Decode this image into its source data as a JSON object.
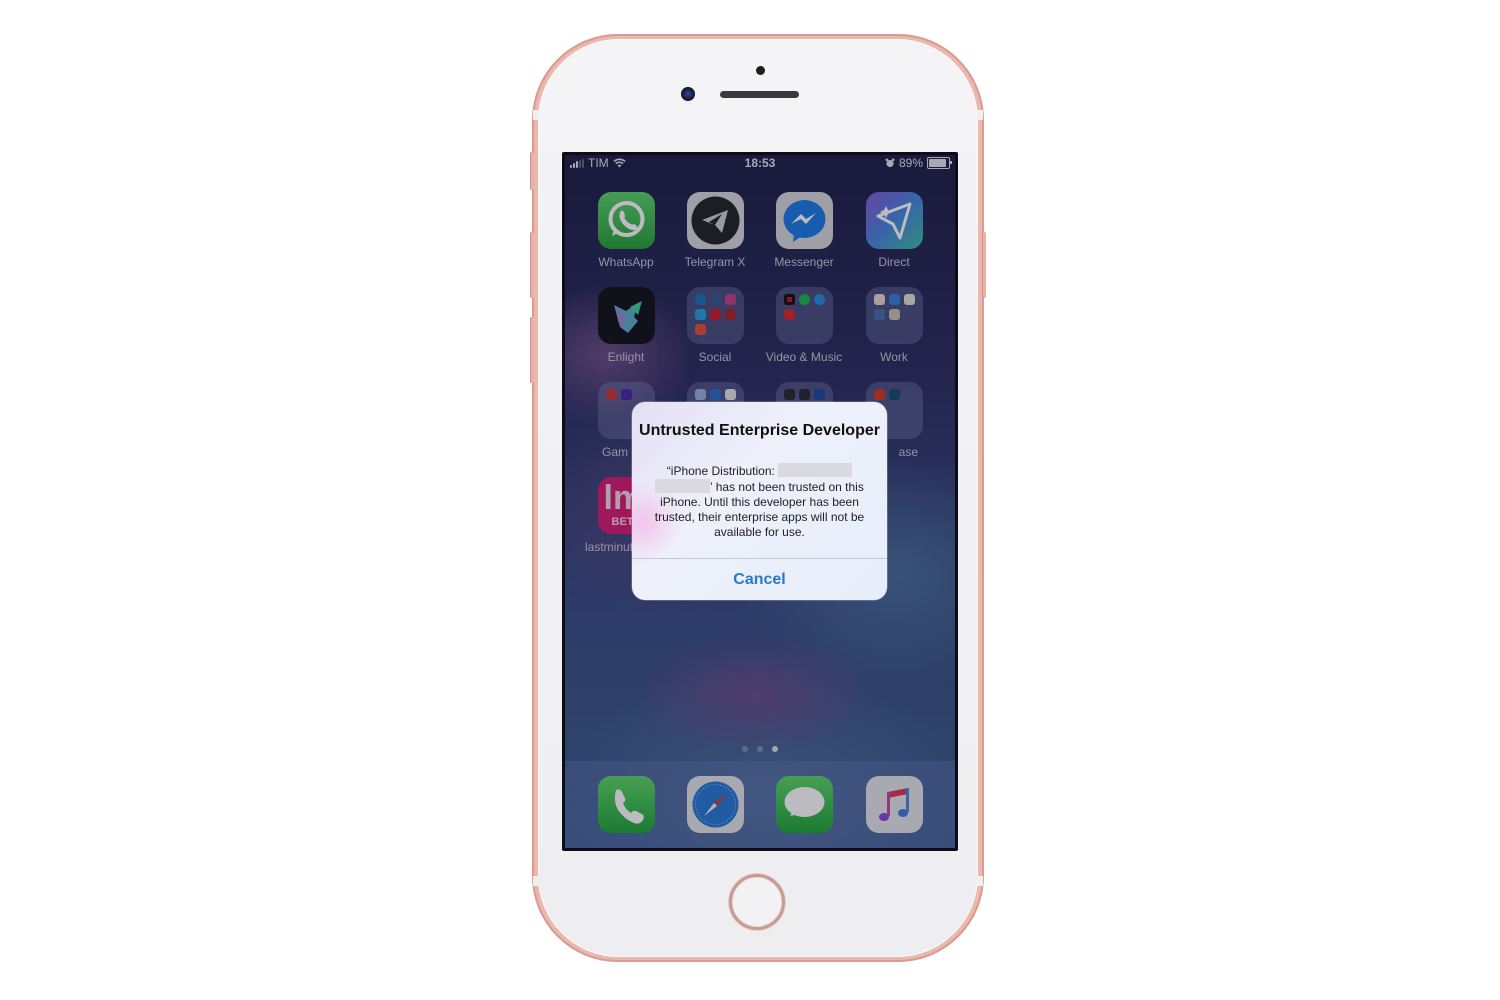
{
  "device": {
    "model": "iPhone (rose gold)",
    "colors": {
      "frame": "#eab8ae",
      "bezel": "#f2f2f4"
    }
  },
  "status_bar": {
    "carrier": "TIM",
    "time": "18:53",
    "battery_percent_label": "89%",
    "battery_level": 0.89,
    "signal_bars_active": 3,
    "signal_bars_total": 5,
    "icons": [
      "signal-icon",
      "wifi-icon",
      "alarm-icon",
      "battery-icon"
    ]
  },
  "home_screen": {
    "apps": [
      {
        "label": "WhatsApp",
        "icon": "whatsapp-icon"
      },
      {
        "label": "Telegram X",
        "icon": "telegram-icon"
      },
      {
        "label": "Messenger",
        "icon": "messenger-icon"
      },
      {
        "label": "Direct",
        "icon": "direct-icon"
      },
      {
        "label": "Enlight",
        "icon": "enlight-icon"
      },
      {
        "label": "Social",
        "icon": "folder-icon"
      },
      {
        "label": "Video & Music",
        "icon": "folder-icon"
      },
      {
        "label": "Work",
        "icon": "folder-icon"
      },
      {
        "label": "Gam",
        "icon": "folder-icon"
      },
      {
        "label": "",
        "icon": "folder-icon"
      },
      {
        "label": "",
        "icon": "folder-icon"
      },
      {
        "label": "ase",
        "icon": "folder-icon"
      },
      {
        "label": "lastminut",
        "icon": "lastminute-bet-icon",
        "icon_text": "lm",
        "icon_subtext": "BET"
      }
    ],
    "page_dots": {
      "count": 3,
      "active_index": 2
    },
    "dock": [
      {
        "name": "Phone",
        "icon": "phone-icon"
      },
      {
        "name": "Safari",
        "icon": "safari-icon"
      },
      {
        "name": "Messages",
        "icon": "messages-icon"
      },
      {
        "name": "Music",
        "icon": "music-icon"
      }
    ]
  },
  "alert": {
    "title": "Untrusted Enterprise Developer",
    "message_prefix": "“iPhone Distribution:",
    "message_suffix": "’ has not been trusted on this iPhone. Until this developer has been trusted, their enterprise apps will not be available for use.",
    "cancel_label": "Cancel",
    "accent": "#2a78c8"
  }
}
